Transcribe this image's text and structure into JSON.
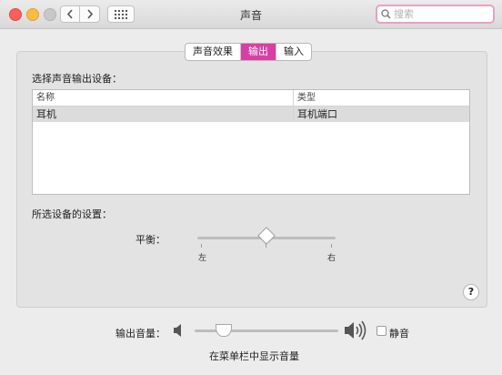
{
  "window": {
    "title": "声音"
  },
  "search": {
    "placeholder": "搜索"
  },
  "tabs": [
    {
      "label": "声音效果",
      "active": false
    },
    {
      "label": "输出",
      "active": true
    },
    {
      "label": "输入",
      "active": false
    }
  ],
  "output": {
    "device_heading": "选择声音输出设备：",
    "table": {
      "columns": [
        "名称",
        "类型"
      ],
      "rows": [
        {
          "name": "耳机",
          "type": "耳机端口"
        }
      ]
    },
    "settings_heading": "所选设备的设置：",
    "balance": {
      "label": "平衡：",
      "left_label": "左",
      "right_label": "右",
      "value_percent": 50
    }
  },
  "volume": {
    "label": "输出音量：",
    "value_percent": 20,
    "mute_label": "静音",
    "mute_checked": false,
    "show_in_menubar_label": "在菜单栏中显示音量"
  },
  "colors": {
    "accent": "#d83fa4",
    "search_border": "#e8a0c6"
  },
  "icons": [
    "back-chevron-icon",
    "forward-chevron-icon",
    "grid-icon",
    "search-icon",
    "speaker-low-icon",
    "speaker-high-icon",
    "help-icon"
  ]
}
